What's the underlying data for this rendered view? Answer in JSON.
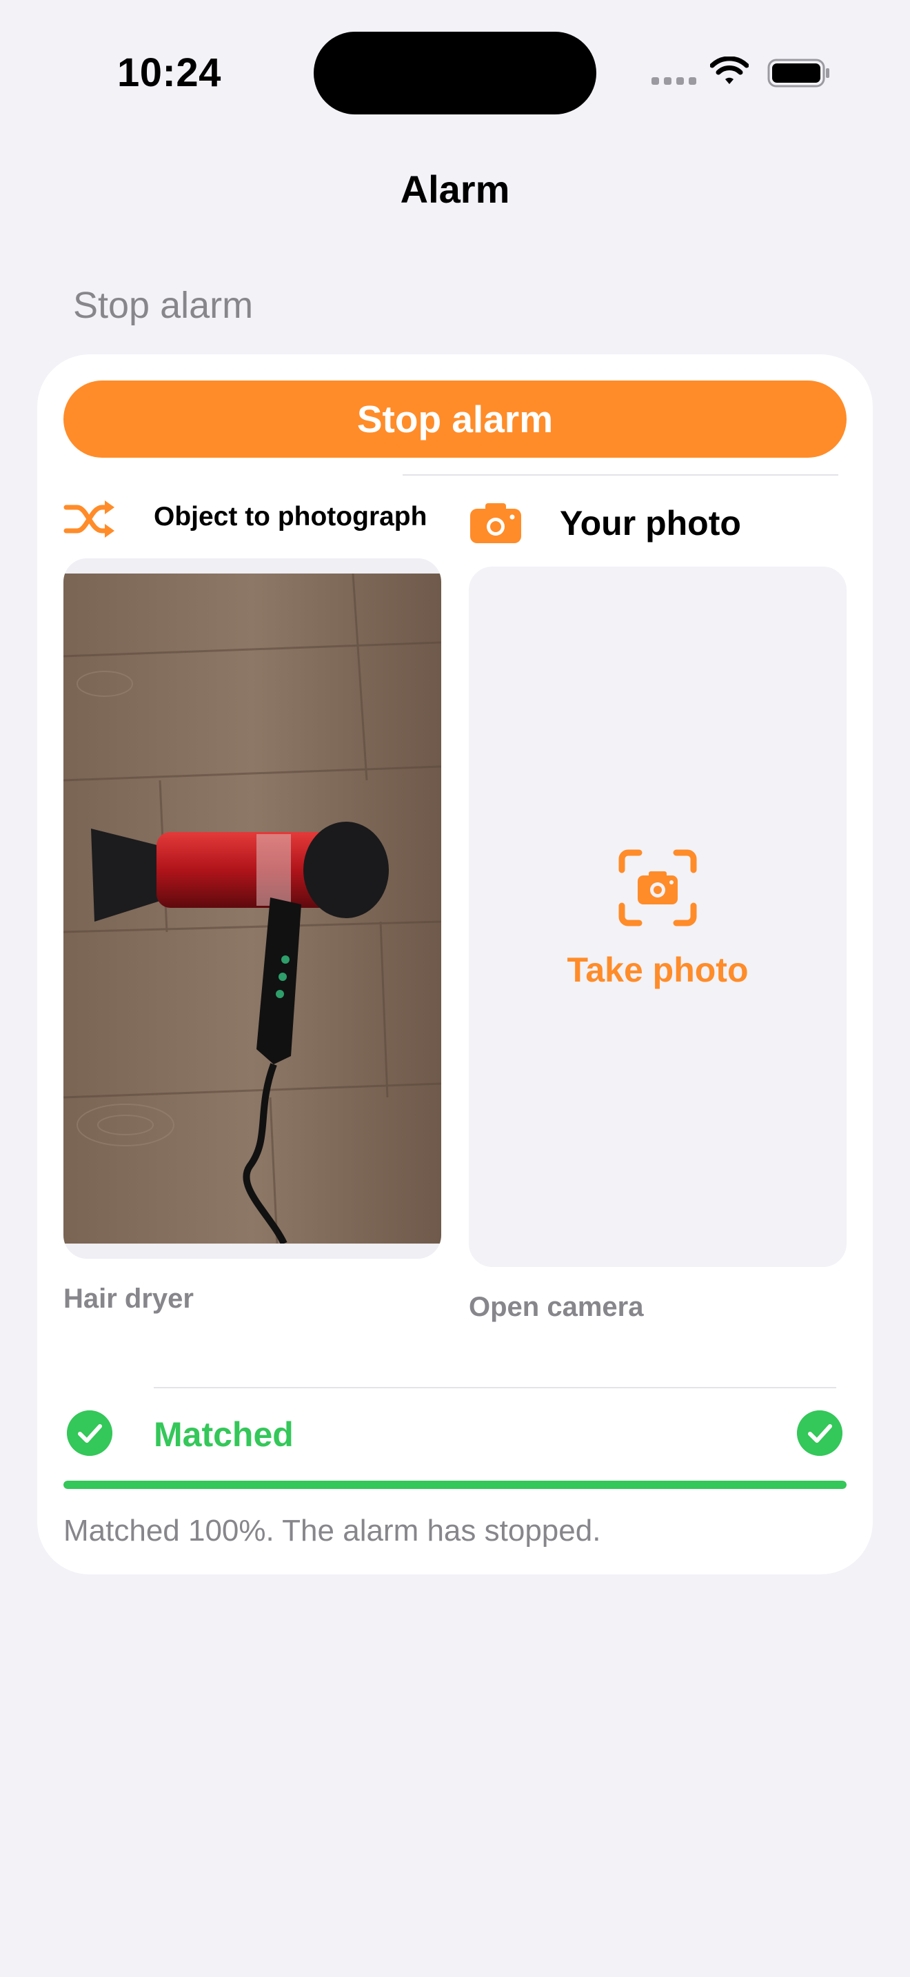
{
  "status_bar": {
    "time": "10:24",
    "icons": [
      "signal-icon",
      "wifi-icon",
      "battery-icon"
    ]
  },
  "nav": {
    "title": "Alarm"
  },
  "section": {
    "header": "Stop alarm"
  },
  "stop_button": {
    "label": "Stop alarm"
  },
  "object_column": {
    "icon": "shuffle-icon",
    "title": "Object to photograph",
    "object_name": "Hair dryer"
  },
  "photo_column": {
    "icon": "camera-icon",
    "title": "Your photo",
    "action_icon": "camera-viewfinder-icon",
    "action_label": "Take photo",
    "caption": "Open camera"
  },
  "match": {
    "status": "Matched",
    "icon": "checkmark-circle-icon",
    "percent": 100,
    "message": "Matched 100%. The alarm has stopped."
  },
  "colors": {
    "accent": "#FF8C29",
    "success": "#34C759",
    "background": "#F2F2F7",
    "secondary_text": "#86868B"
  }
}
